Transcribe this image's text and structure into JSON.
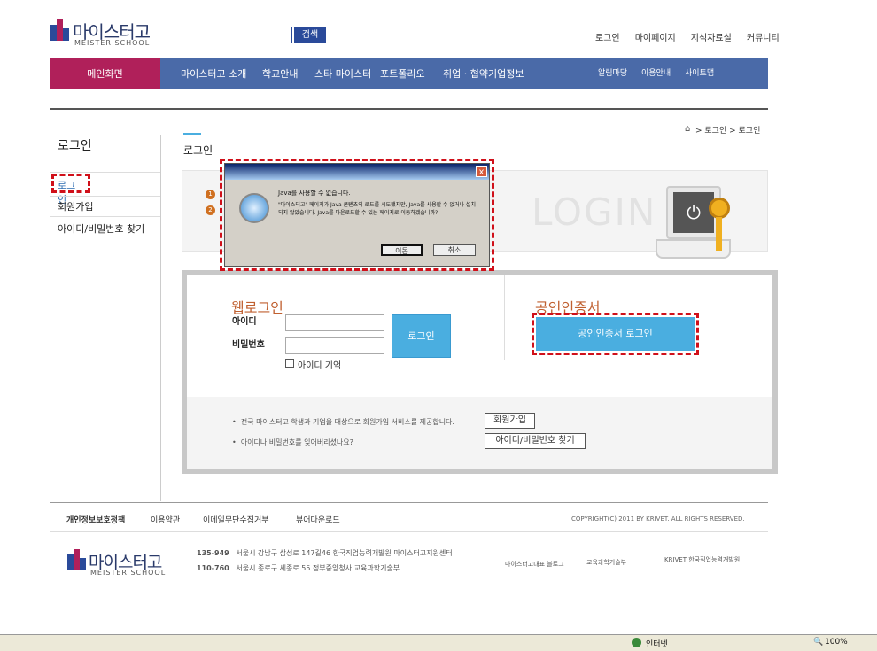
{
  "header": {
    "logo_text": "마이스터고",
    "logo_sub": "MEISTER SCHOOL",
    "search_button": "검색",
    "top_links": [
      "로그인",
      "마이페이지",
      "지식자료실",
      "커뮤니티"
    ]
  },
  "nav": {
    "home": "메인화면",
    "items": [
      "마이스터고 소개",
      "학교안내",
      "스타 마이스터",
      "포트폴리오",
      "취업 · 협약기업정보"
    ],
    "right_items": [
      "알림마당",
      "이용안내",
      "사이트맵"
    ]
  },
  "sidebar": {
    "title": "로그인",
    "items": [
      "로그인",
      "회원가입",
      "아이디/비밀번호 찾기"
    ]
  },
  "breadcrumb": "로그인 > 로그인",
  "main": {
    "title": "로그인",
    "banner_text": "LOGIN"
  },
  "dialog": {
    "message_title": "Java를 사용할 수 없습니다.",
    "message_body": "\"마이스터고\" 페이지가 Java 콘텐츠의 로드를 시도했지만, Java를 사용할 수 없거나 설치되지 않았습니다. Java를 다운로드할 수 있는 페이지로 이동하겠습니까?",
    "ok_button": "이동",
    "cancel_button": "취소",
    "close": "x"
  },
  "login": {
    "web_heading": "웹로그인",
    "id_label": "아이디",
    "pw_label": "비밀번호",
    "login_button": "로그인",
    "remember_label": "아이디 기억",
    "cert_heading": "공인인증서",
    "cert_button": "공인인증서 로그인"
  },
  "info": {
    "row1": "전국 마이스터고 학생과 기업을 대상으로 회원가입 서비스를 제공합니다.",
    "row1_button": "회원가입",
    "row2": "아이디나 비밀번호를 잊어버리셨나요?",
    "row2_button": "아이디/비밀번호 찾기"
  },
  "footer": {
    "links": [
      "개인정보보호정책",
      "이용약관",
      "이메일무단수집거부",
      "뷰어다운로드"
    ],
    "copyright": "COPYRIGHT(C) 2011 BY KRIVET. ALL RIGHTS RESERVED.",
    "addr1_zip": "135-949",
    "addr1": "서울시 강남구 삼성로 147길46 한국직업능력개발원 마이스터고지원센터",
    "addr2_zip": "110-760",
    "addr2": "서울시 종로구 세종로 55 정부중앙청사 교육과학기술부",
    "partners": [
      "마이스터고대표 블로그",
      "교육과학기술부",
      "KRIVET 한국직업능력개발원"
    ]
  },
  "status": {
    "zone": "인터넷",
    "zoom": "100%"
  },
  "colors": {
    "nav": "#4a6aa8",
    "home": "#b0205a",
    "accent": "#4aaee0",
    "highlight": "#d0101a"
  }
}
